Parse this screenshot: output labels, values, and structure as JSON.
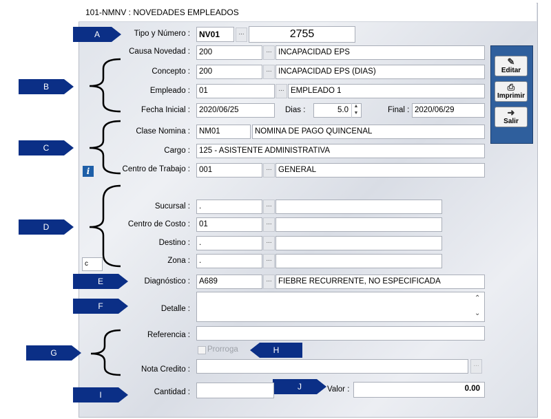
{
  "window": {
    "title": "101-NMNV : NOVEDADES EMPLEADOS"
  },
  "markers": [
    "A",
    "B",
    "C",
    "D",
    "E",
    "F",
    "G",
    "H",
    "I",
    "J"
  ],
  "fields": {
    "tipo": {
      "label": "Tipo y Número :",
      "code": "NV01",
      "number": "2755"
    },
    "causa": {
      "label": "Causa Novedad :",
      "code": "200",
      "desc": "INCAPACIDAD EPS"
    },
    "concepto": {
      "label": "Concepto :",
      "code": "200",
      "desc": "INCAPACIDAD EPS (DIAS)"
    },
    "empleado": {
      "label": "Empleado :",
      "code": "01",
      "desc": "EMPLEADO 1"
    },
    "fecha": {
      "label": "Fecha Inicial :",
      "value": "2020/06/25",
      "dias_label": "Dias :",
      "dias": "5.0",
      "final_label": "Final :",
      "final": "2020/06/29"
    },
    "clase": {
      "label": "Clase Nomina :",
      "code": "NM01",
      "desc": "NOMINA DE PAGO QUINCENAL"
    },
    "cargo": {
      "label": "Cargo :",
      "value": "125 - ASISTENTE ADMINISTRATIVA"
    },
    "centro_trabajo": {
      "label": "Centro de Trabajo :",
      "code": "001",
      "desc": "GENERAL"
    },
    "sucursal": {
      "label": "Sucursal :",
      "code": ".",
      "desc": ""
    },
    "centro_costo": {
      "label": "Centro de Costo :",
      "code": "01",
      "desc": ""
    },
    "destino": {
      "label": "Destino :",
      "code": ".",
      "desc": ""
    },
    "zona": {
      "label": "Zona :",
      "code": ".",
      "desc": ""
    },
    "diagnostico": {
      "label": "Diagnóstico :",
      "code": "A689",
      "desc": "FIEBRE RECURRENTE, NO ESPECIFICADA"
    },
    "detalle": {
      "label": "Detalle :",
      "value": ""
    },
    "referencia": {
      "label": "Referencia :",
      "value": ""
    },
    "prorroga": {
      "label": "Prorroga"
    },
    "nota_credito": {
      "label": "Nota Credito :",
      "value": ""
    },
    "cantidad": {
      "label": "Cantidad :",
      "value": ""
    },
    "valor": {
      "label": "Valor :",
      "value": "0.00"
    },
    "small_box": "c"
  },
  "sidebar": {
    "editar": "Editar",
    "imprimir": "Imprimir",
    "salir": "Salir"
  },
  "icons": {
    "info": "info-icon",
    "editar": "edit-icon",
    "imprimir": "printer-icon",
    "salir": "exit-icon"
  }
}
